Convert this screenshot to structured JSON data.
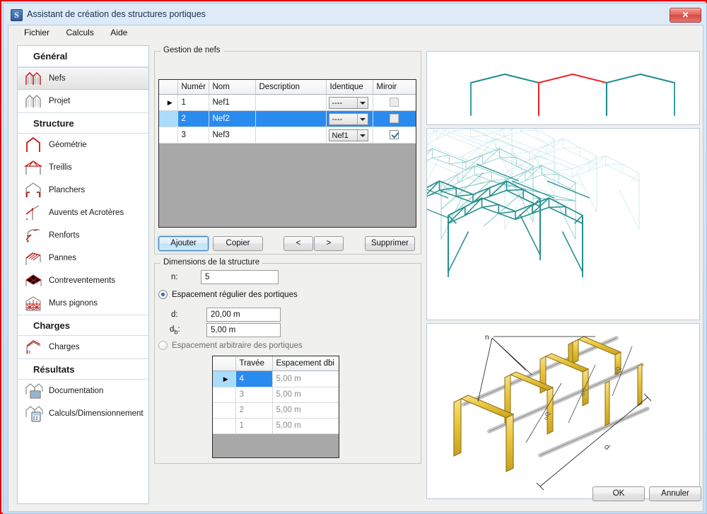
{
  "window": {
    "title": "Assistant de création des structures portiques",
    "icon": "S",
    "close_label": "✕"
  },
  "menubar": [
    {
      "label": "Fichier",
      "name": "menu-fichier"
    },
    {
      "label": "Calculs",
      "name": "menu-calculs"
    },
    {
      "label": "Aide",
      "name": "menu-aide"
    }
  ],
  "sidebar": {
    "groups": [
      {
        "header": "Général",
        "items": [
          {
            "label": "Nefs",
            "icon": "portal-frames-icon",
            "selected": true
          },
          {
            "label": "Projet",
            "icon": "project-frames-icon",
            "selected": false
          }
        ]
      },
      {
        "header": "Structure",
        "items": [
          {
            "label": "Géométrie",
            "icon": "geometry-icon",
            "selected": false
          },
          {
            "label": "Treillis",
            "icon": "truss-icon",
            "selected": false
          },
          {
            "label": "Planchers",
            "icon": "floors-icon",
            "selected": false
          },
          {
            "label": "Auvents et Acrotères",
            "icon": "canopy-icon",
            "selected": false
          },
          {
            "label": "Renforts",
            "icon": "reinforcement-icon",
            "selected": false
          },
          {
            "label": "Pannes",
            "icon": "purlins-icon",
            "selected": false
          },
          {
            "label": "Contreventements",
            "icon": "bracing-icon",
            "selected": false
          },
          {
            "label": "Murs pignons",
            "icon": "gable-walls-icon",
            "selected": false
          }
        ]
      },
      {
        "header": "Charges",
        "items": [
          {
            "label": "Charges",
            "icon": "loads-icon",
            "selected": false
          }
        ]
      },
      {
        "header": "Résultats",
        "items": [
          {
            "label": "Documentation",
            "icon": "documentation-icon",
            "selected": false
          },
          {
            "label": "Calculs/Dimensionnement",
            "icon": "calculation-icon",
            "selected": false
          }
        ]
      }
    ]
  },
  "nefs_panel": {
    "title": "Gestion de nefs",
    "columns": [
      "",
      "Numér",
      "Nom",
      "Description",
      "Identique",
      "Miroir"
    ],
    "rows": [
      {
        "indicator": "▶",
        "numero": "1",
        "nom": "Nef1",
        "description": "",
        "identique": "----",
        "miroir": false,
        "miroir_disabled": true,
        "selected": false
      },
      {
        "indicator": "",
        "numero": "2",
        "nom": "Nef2",
        "description": "",
        "identique": "----",
        "miroir": false,
        "miroir_disabled": true,
        "selected": true
      },
      {
        "indicator": "",
        "numero": "3",
        "nom": "Nef3",
        "description": "",
        "identique": "Nef1",
        "miroir": true,
        "miroir_disabled": false,
        "selected": false
      }
    ],
    "buttons": {
      "add": "Ajouter",
      "copy": "Copier",
      "prev": "<",
      "next": ">",
      "delete": "Supprimer"
    }
  },
  "dimensions_panel": {
    "title": "Dimensions de la structure",
    "n_label": "n:",
    "n_value": "5",
    "regular_option": "Espacement régulier des portiques",
    "regular_selected": true,
    "d_label": "d:",
    "d_value": "20,00 m",
    "db_label_base": "d",
    "db_label_sub": "b",
    "db_label_suffix": ":",
    "db_value": "5,00 m",
    "arbitrary_option": "Espacement arbitraire des portiques",
    "arbitrary_selected": false,
    "travee_columns": [
      "",
      "Travée",
      "Espacement dbi"
    ],
    "travee_rows": [
      {
        "indicator": "▶",
        "travee": "4",
        "espacement": "5,00 m",
        "selected": true
      },
      {
        "indicator": "",
        "travee": "3",
        "espacement": "5,00 m",
        "selected": false
      },
      {
        "indicator": "",
        "travee": "2",
        "espacement": "5,00 m",
        "selected": false
      },
      {
        "indicator": "",
        "travee": "1",
        "espacement": "5,00 m",
        "selected": false
      }
    ]
  },
  "previews": {
    "cross_section": {
      "name": "cross-section-preview",
      "bay_color": "#1a8b8b",
      "selected_bay_color": "#ee2020",
      "bays": 3,
      "selected_bay_index": 2
    },
    "wireframe_3d": {
      "name": "wireframe-3d-preview",
      "color": "#2a9d9d"
    },
    "dimension_diagram": {
      "name": "dimension-diagram-preview",
      "member_color": "#e8c43a",
      "labels": {
        "n": "n",
        "db": "d",
        "db_sub": "b",
        "d": "d"
      }
    }
  },
  "footer": {
    "ok": "OK",
    "cancel": "Annuler"
  }
}
